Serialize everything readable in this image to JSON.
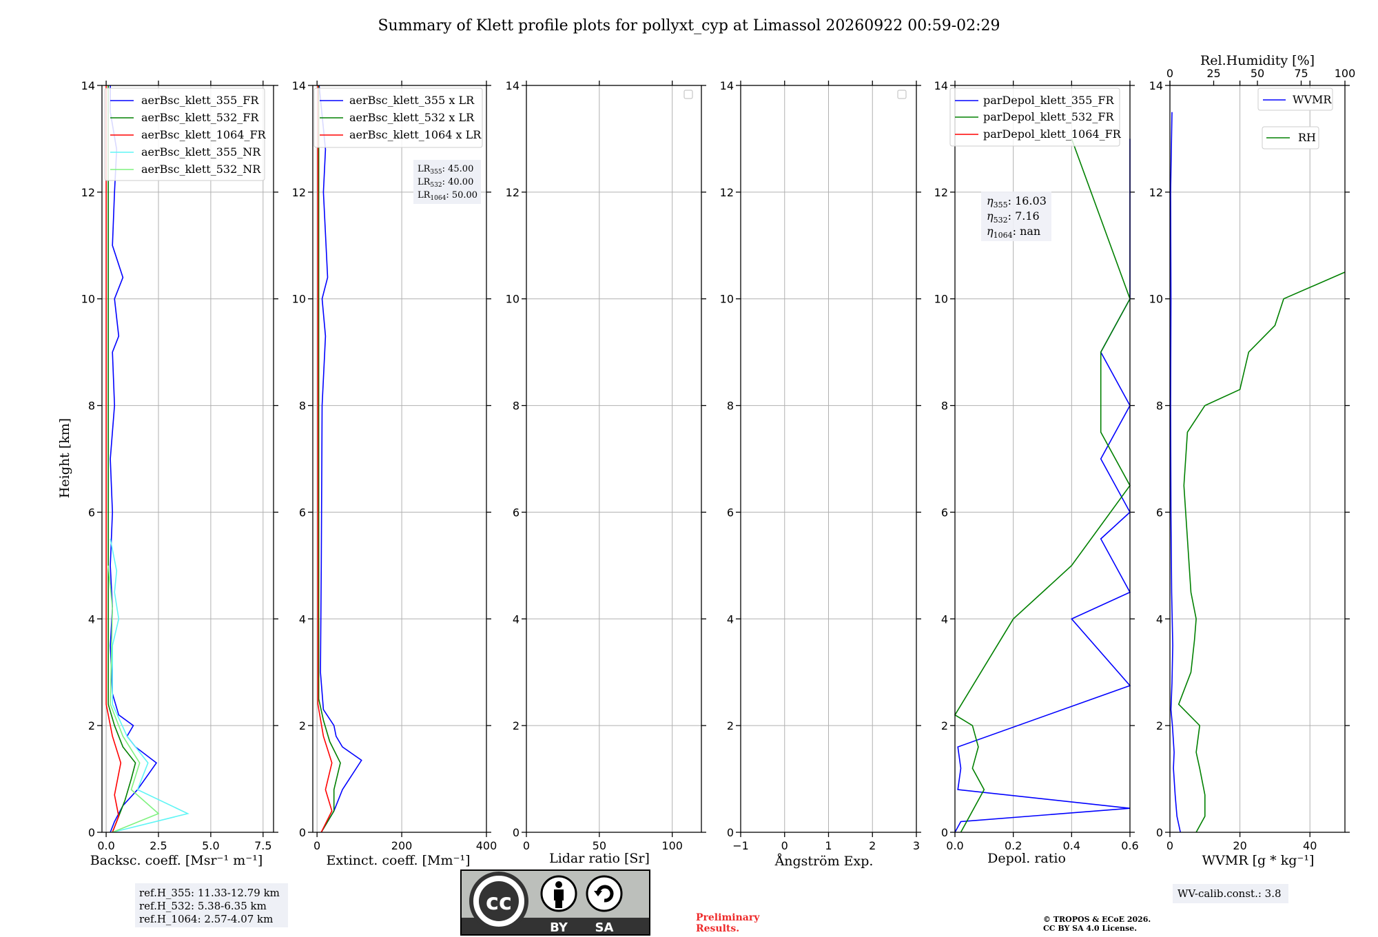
{
  "title": "Summary of Klett profile plots for pollyxt_cyp at Limassol 20260922 00:59-02:29",
  "shared_ylabel": "Height [km]",
  "colors": {
    "blue": "#0000ff",
    "green": "#008000",
    "red": "#ff0000",
    "cyan": "#5ff5f5",
    "lightgreen": "#7ff27f"
  },
  "panels": {
    "bsc": {
      "xlabel": "Backsc. coeff. [Msr⁻¹ m⁻¹]",
      "xticks": [
        "0.0",
        "2.5",
        "5.0",
        "7.5"
      ],
      "legend": [
        "aerBsc_klett_355_FR",
        "aerBsc_klett_532_FR",
        "aerBsc_klett_1064_FR",
        "aerBsc_klett_355_NR",
        "aerBsc_klett_532_NR"
      ],
      "refh": [
        "ref.H_355: 11.33-12.79 km",
        "ref.H_532: 5.38-6.35 km",
        "ref.H_1064: 2.57-4.07 km"
      ]
    },
    "ext": {
      "xlabel": "Extinct. coeff. [Mm⁻¹]",
      "xticks": [
        "0",
        "200",
        "400"
      ],
      "legend": [
        "aerBsc_klett_355 x LR",
        "aerBsc_klett_532 x LR",
        "aerBsc_klett_1064 x LR"
      ],
      "lr": [
        {
          "label": "LR",
          "sub": "355",
          "value": ": 45.00"
        },
        {
          "label": "LR",
          "sub": "532",
          "value": ": 40.00"
        },
        {
          "label": "LR",
          "sub": "1064",
          "value": ": 50.00"
        }
      ]
    },
    "lidar": {
      "xlabel": "Lidar ratio [Sr]",
      "xticks": [
        "0",
        "50",
        "100"
      ]
    },
    "angstrom": {
      "xlabel": "Ångström Exp.",
      "xticks": [
        "−1",
        "0",
        "1",
        "2",
        "3"
      ]
    },
    "depol": {
      "xlabel": "Depol. ratio",
      "xticks": [
        "0.0",
        "0.2",
        "0.4",
        "0.6"
      ],
      "legend": [
        "parDepol_klett_355_FR",
        "parDepol_klett_532_FR",
        "parDepol_klett_1064_FR"
      ],
      "eta": [
        {
          "label": "η",
          "sub": "355",
          "value": ": 16.03"
        },
        {
          "label": "η",
          "sub": "532",
          "value": ": 7.16"
        },
        {
          "label": "η",
          "sub": "1064",
          "value": ": nan"
        }
      ]
    },
    "wvmr": {
      "xlabel": "WVMR [g * kg⁻¹]",
      "xticks": [
        "0",
        "20",
        "40"
      ],
      "top_label": "Rel.Humidity [%]",
      "top_ticks": [
        "0",
        "25",
        "50",
        "75",
        "100"
      ],
      "legend_wvmr": "WVMR",
      "legend_rh": "RH",
      "calib": "WV-calib.const.: 3.8"
    }
  },
  "license": {
    "by": "BY",
    "sa": "SA",
    "cc": "cc"
  },
  "prelim": [
    "Preliminary",
    "Results."
  ],
  "copyright": [
    "© TROPOS & ECoE 2026.",
    "CC BY SA 4.0 License."
  ],
  "chart_data": [
    {
      "type": "line",
      "xlabel": "Backsc. coeff. [Msr⁻¹ m⁻¹]",
      "ylabel": "Height [km]",
      "xlim": [
        -0.2,
        8
      ],
      "ylim": [
        0,
        14
      ],
      "grid": true,
      "legend_position": "upper-right",
      "series": [
        {
          "name": "aerBsc_klett_355_FR",
          "color": "#0000ff",
          "points": [
            [
              0.2,
              0
            ],
            [
              0.4,
              0.2
            ],
            [
              0.8,
              0.5
            ],
            [
              1.5,
              0.8
            ],
            [
              2.4,
              1.3
            ],
            [
              1.4,
              1.6
            ],
            [
              1.0,
              1.8
            ],
            [
              1.3,
              2.0
            ],
            [
              0.6,
              2.2
            ],
            [
              0.3,
              2.6
            ],
            [
              0.2,
              3.5
            ],
            [
              0.3,
              4.2
            ],
            [
              0.2,
              5
            ],
            [
              0.3,
              6
            ],
            [
              0.2,
              7
            ],
            [
              0.4,
              8
            ],
            [
              0.3,
              9
            ],
            [
              0.6,
              9.3
            ],
            [
              0.4,
              10
            ],
            [
              0.8,
              10.4
            ],
            [
              0.3,
              11
            ],
            [
              0.4,
              12
            ],
            [
              0.5,
              12.8
            ],
            [
              0.2,
              13.5
            ],
            [
              0.2,
              14
            ]
          ]
        },
        {
          "name": "aerBsc_klett_532_FR",
          "color": "#008000",
          "points": [
            [
              0.3,
              0
            ],
            [
              0.6,
              0.3
            ],
            [
              0.9,
              0.6
            ],
            [
              1.2,
              1.0
            ],
            [
              1.4,
              1.3
            ],
            [
              0.8,
              1.6
            ],
            [
              0.4,
              2.0
            ],
            [
              0.1,
              2.4
            ],
            [
              0.1,
              4
            ],
            [
              0.1,
              8
            ],
            [
              0.1,
              14
            ]
          ]
        },
        {
          "name": "aerBsc_klett_1064_FR",
          "color": "#ff0000",
          "points": [
            [
              0.3,
              0
            ],
            [
              0.6,
              0.3
            ],
            [
              0.4,
              0.7
            ],
            [
              0.7,
              1.3
            ],
            [
              0.3,
              1.8
            ],
            [
              0.0,
              2.4
            ],
            [
              0.0,
              14
            ]
          ]
        },
        {
          "name": "aerBsc_klett_355_NR",
          "color": "#5ff5f5",
          "points": [
            [
              0.3,
              0
            ],
            [
              3.9,
              0.35
            ],
            [
              1.5,
              0.8
            ],
            [
              2.0,
              1.3
            ],
            [
              1.0,
              1.8
            ],
            [
              0.3,
              2.4
            ],
            [
              0.3,
              3.5
            ],
            [
              0.6,
              4.0
            ],
            [
              0.4,
              4.5
            ],
            [
              0.5,
              4.9
            ],
            [
              0.2,
              5.5
            ]
          ]
        },
        {
          "name": "aerBsc_klett_532_NR",
          "color": "#7ff27f",
          "points": [
            [
              0.3,
              0
            ],
            [
              2.5,
              0.35
            ],
            [
              1.2,
              0.8
            ],
            [
              1.6,
              1.3
            ],
            [
              0.8,
              1.8
            ],
            [
              0.2,
              2.4
            ],
            [
              0.3,
              4.2
            ],
            [
              0.1,
              5
            ]
          ]
        }
      ]
    },
    {
      "type": "line",
      "xlabel": "Extinct. coeff. [Mm⁻¹]",
      "ylabel": "Height [km]",
      "xlim": [
        -10,
        400
      ],
      "ylim": [
        0,
        14
      ],
      "grid": true,
      "legend_position": "upper-right",
      "series": [
        {
          "name": "aerBsc_klett_355 x LR",
          "color": "#0000ff",
          "points": [
            [
              10,
              0
            ],
            [
              40,
              0.4
            ],
            [
              60,
              0.8
            ],
            [
              105,
              1.35
            ],
            [
              60,
              1.6
            ],
            [
              45,
              1.8
            ],
            [
              40,
              2.0
            ],
            [
              15,
              2.3
            ],
            [
              8,
              3
            ],
            [
              10,
              5
            ],
            [
              12,
              8
            ],
            [
              20,
              9.3
            ],
            [
              12,
              10
            ],
            [
              25,
              10.4
            ],
            [
              15,
              12
            ],
            [
              20,
              12.8
            ],
            [
              5,
              14
            ]
          ]
        },
        {
          "name": "aerBsc_klett_532 x LR",
          "color": "#008000",
          "points": [
            [
              10,
              0
            ],
            [
              40,
              0.4
            ],
            [
              40,
              0.8
            ],
            [
              55,
              1.3
            ],
            [
              30,
              1.7
            ],
            [
              15,
              2.1
            ],
            [
              4,
              2.5
            ],
            [
              4,
              14
            ]
          ]
        },
        {
          "name": "aerBsc_klett_1064 x LR",
          "color": "#ff0000",
          "points": [
            [
              10,
              0
            ],
            [
              35,
              0.4
            ],
            [
              20,
              0.8
            ],
            [
              35,
              1.3
            ],
            [
              15,
              1.8
            ],
            [
              2,
              2.4
            ],
            [
              2,
              14
            ]
          ]
        }
      ]
    },
    {
      "type": "line",
      "xlabel": "Lidar ratio [Sr]",
      "ylabel": "Height [km]",
      "xlim": [
        0,
        120
      ],
      "ylim": [
        0,
        14
      ],
      "grid": true,
      "series": []
    },
    {
      "type": "line",
      "xlabel": "Ångström Exp.",
      "ylabel": "Height [km]",
      "xlim": [
        -1,
        3
      ],
      "ylim": [
        0,
        14
      ],
      "grid": true,
      "series": []
    },
    {
      "type": "line",
      "xlabel": "Depol. ratio",
      "ylabel": "Height [km]",
      "xlim": [
        0,
        0.6
      ],
      "ylim": [
        0,
        14
      ],
      "grid": true,
      "legend_position": "upper-left",
      "series": [
        {
          "name": "parDepol_klett_355_FR",
          "color": "#0000ff",
          "points": [
            [
              0.0,
              0.0
            ],
            [
              0.02,
              0.2
            ],
            [
              0.6,
              0.45
            ],
            [
              0.01,
              0.8
            ],
            [
              0.02,
              1.2
            ],
            [
              0.01,
              1.6
            ],
            [
              0.6,
              2.75
            ],
            [
              0.4,
              4.0
            ],
            [
              0.6,
              4.5
            ],
            [
              0.5,
              5.5
            ],
            [
              0.6,
              6.0
            ],
            [
              0.5,
              7
            ],
            [
              0.6,
              8
            ],
            [
              0.5,
              9
            ],
            [
              0.6,
              10
            ],
            [
              0.6,
              12
            ],
            [
              0.6,
              13
            ]
          ]
        },
        {
          "name": "parDepol_klett_532_FR",
          "color": "#008000",
          "points": [
            [
              0.02,
              0
            ],
            [
              0.1,
              0.8
            ],
            [
              0.06,
              1.2
            ],
            [
              0.08,
              1.6
            ],
            [
              0.06,
              2.0
            ],
            [
              0.0,
              2.2
            ],
            [
              0.2,
              4.0
            ],
            [
              0.4,
              5.0
            ],
            [
              0.6,
              6.5
            ],
            [
              0.5,
              7.5
            ],
            [
              0.5,
              9
            ],
            [
              0.6,
              10
            ],
            [
              0.5,
              11.5
            ],
            [
              0.4,
              13
            ]
          ]
        },
        {
          "name": "parDepol_klett_1064_FR",
          "color": "#ff0000",
          "points": []
        }
      ]
    },
    {
      "type": "line",
      "xlabel": "WVMR [g * kg⁻¹]",
      "ylabel": "Height [km]",
      "xlim": [
        0,
        50
      ],
      "ylim": [
        0,
        14
      ],
      "top_axis": {
        "label": "Rel.Humidity [%]",
        "range": [
          0,
          100
        ]
      },
      "grid": true,
      "legend_position": "upper-right",
      "series": [
        {
          "name": "WVMR",
          "color": "#0000ff",
          "axis": "bottom",
          "points": [
            [
              3,
              0
            ],
            [
              2,
              0.3
            ],
            [
              1.5,
              0.7
            ],
            [
              1,
              1.2
            ],
            [
              1.2,
              1.5
            ],
            [
              0.7,
              2.0
            ],
            [
              0.3,
              2.3
            ],
            [
              0.6,
              2.8
            ],
            [
              0.8,
              3.5
            ],
            [
              0.5,
              4.5
            ],
            [
              0.3,
              6
            ],
            [
              0.2,
              8
            ],
            [
              0.3,
              10
            ],
            [
              0.2,
              12
            ],
            [
              0.6,
              13.5
            ]
          ]
        },
        {
          "name": "RH",
          "color": "#008000",
          "axis": "top",
          "points": [
            [
              15,
              0
            ],
            [
              20,
              0.3
            ],
            [
              20,
              0.7
            ],
            [
              17,
              1.2
            ],
            [
              15,
              1.5
            ],
            [
              17,
              2.0
            ],
            [
              5,
              2.4
            ],
            [
              12,
              3.0
            ],
            [
              14,
              3.6
            ],
            [
              15,
              4.0
            ],
            [
              12,
              4.5
            ],
            [
              10,
              5.5
            ],
            [
              8,
              6.5
            ],
            [
              10,
              7.5
            ],
            [
              20,
              8.0
            ],
            [
              40,
              8.3
            ],
            [
              45,
              9.0
            ],
            [
              60,
              9.5
            ],
            [
              65,
              10.0
            ],
            [
              100,
              10.5
            ]
          ]
        }
      ]
    }
  ]
}
